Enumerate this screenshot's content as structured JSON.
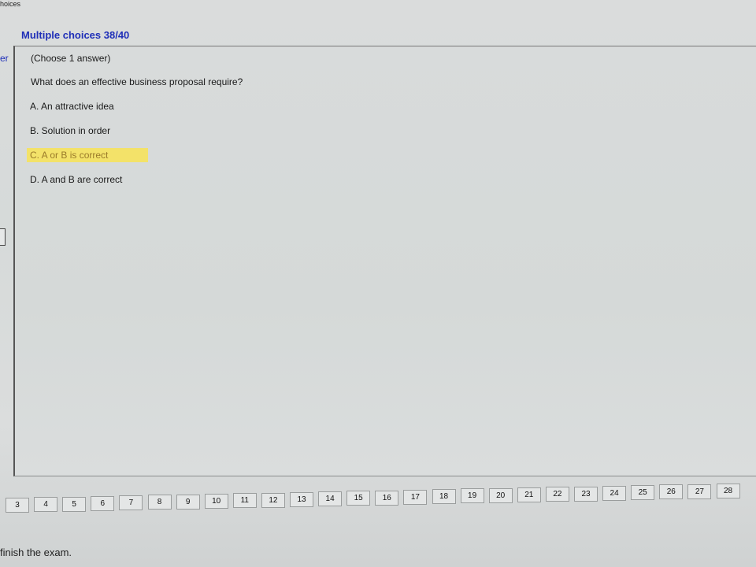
{
  "window": {
    "title": "hoices"
  },
  "header": {
    "title": "Multiple choices 38/40"
  },
  "left_edge": {
    "label": "er"
  },
  "question": {
    "instruction": "(Choose 1 answer)",
    "text": "What does an effective business proposal require?",
    "options": [
      {
        "label": "A.  An attractive idea"
      },
      {
        "label": "B.  Solution in order"
      },
      {
        "label": "C.  A or B is correct",
        "selected": true
      },
      {
        "label": "D.  A and B are correct"
      }
    ]
  },
  "pager": {
    "pages": [
      "3",
      "4",
      "5",
      "6",
      "7",
      "8",
      "9",
      "10",
      "11",
      "12",
      "13",
      "14",
      "15",
      "16",
      "17",
      "18",
      "19",
      "20",
      "21",
      "22",
      "23",
      "24",
      "25",
      "26",
      "27",
      "28"
    ]
  },
  "footer": {
    "text": "finish the exam."
  },
  "colors": {
    "accent": "#1f2fb8",
    "selection": "#f3e269"
  }
}
